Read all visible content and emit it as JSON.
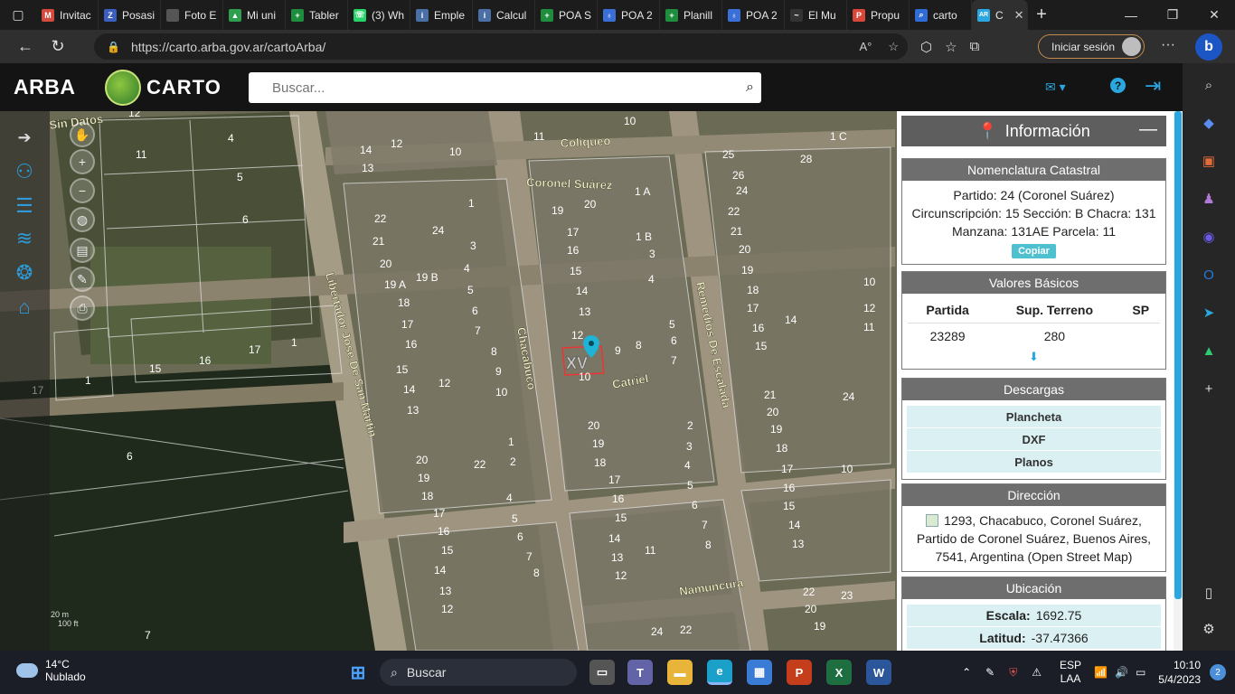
{
  "browser": {
    "tabs": [
      {
        "label": "Invitac",
        "fav_color": "#d24b3e",
        "fav_char": "M"
      },
      {
        "label": "Posasi",
        "fav_color": "#3a5fbf",
        "fav_char": "Z"
      },
      {
        "label": "Foto E",
        "fav_color": "#555555",
        "fav_char": ""
      },
      {
        "label": "Mi uni",
        "fav_color": "#2e9e4f",
        "fav_char": "▲"
      },
      {
        "label": "Tabler",
        "fav_color": "#1e8e3e",
        "fav_char": "+"
      },
      {
        "label": "(3) Wh",
        "fav_color": "#25d366",
        "fav_char": "☏"
      },
      {
        "label": "Emple",
        "fav_color": "#4a6fa5",
        "fav_char": "i"
      },
      {
        "label": "Calcul",
        "fav_color": "#4a6fa5",
        "fav_char": "i"
      },
      {
        "label": "POA S",
        "fav_color": "#1e8e3e",
        "fav_char": "+"
      },
      {
        "label": "POA 2",
        "fav_color": "#3b6fd8",
        "fav_char": "♁"
      },
      {
        "label": "Planill",
        "fav_color": "#1e8e3e",
        "fav_char": "+"
      },
      {
        "label": "POA 2",
        "fav_color": "#3b6fd8",
        "fav_char": "♁"
      },
      {
        "label": "El Mu",
        "fav_color": "#333333",
        "fav_char": "~"
      },
      {
        "label": "Propu",
        "fav_color": "#d9473b",
        "fav_char": "P"
      },
      {
        "label": "carto",
        "fav_color": "#2f6cd8",
        "fav_char": "⌕"
      }
    ],
    "active_tab": {
      "label": "C",
      "fav_char": "AR"
    },
    "url": "https://carto.arba.gov.ar/cartoArba/",
    "signin_label": "Iniciar sesión"
  },
  "app": {
    "brand": "ARBA",
    "product": "CARTO",
    "search_placeholder": "Buscar..."
  },
  "map": {
    "streets": [
      "Coliqueo",
      "Coronel Suárez",
      "Chacabuco",
      "Remedios De Escalada",
      "Libertador Jose De San Martin",
      "Catriel",
      "Namuncura",
      "Sin Datos"
    ],
    "parcel_marker": "XV",
    "scale_labels": [
      "20 m",
      "100 ft"
    ]
  },
  "info": {
    "title": "Información",
    "nomenclatura": {
      "header": "Nomenclatura Catastral",
      "line1": "Partido: 24 (Coronel Suárez)",
      "line2": "Circunscripción: 15 Sección: B Chacra: 131",
      "line3": "Manzana: 131AE Parcela: 11",
      "copy_label": "Copiar"
    },
    "valores": {
      "header": "Valores Básicos",
      "col_partida": "Partida",
      "col_sup": "Sup. Terreno",
      "col_sp": "SP",
      "partida": "23289",
      "sup": "280",
      "sp": ""
    },
    "descargas": {
      "header": "Descargas",
      "items": [
        "Plancheta",
        "DXF",
        "Planos"
      ]
    },
    "direccion": {
      "header": "Dirección",
      "text": "1293, Chacabuco, Coronel Suárez, Partido de Coronel Suárez, Buenos Aires, 7541, Argentina (Open Street Map)"
    },
    "ubicacion": {
      "header": "Ubicación",
      "escala_label": "Escala:",
      "escala": "1692.75",
      "latitud_label": "Latitud:",
      "latitud": "-37.47366"
    }
  },
  "taskbar": {
    "weather_temp": "14°C",
    "weather_desc": "Nublado",
    "search_label": "Buscar",
    "lang1": "ESP",
    "lang2": "LAA",
    "time": "10:10",
    "date": "5/4/2023",
    "notifications": "2"
  }
}
